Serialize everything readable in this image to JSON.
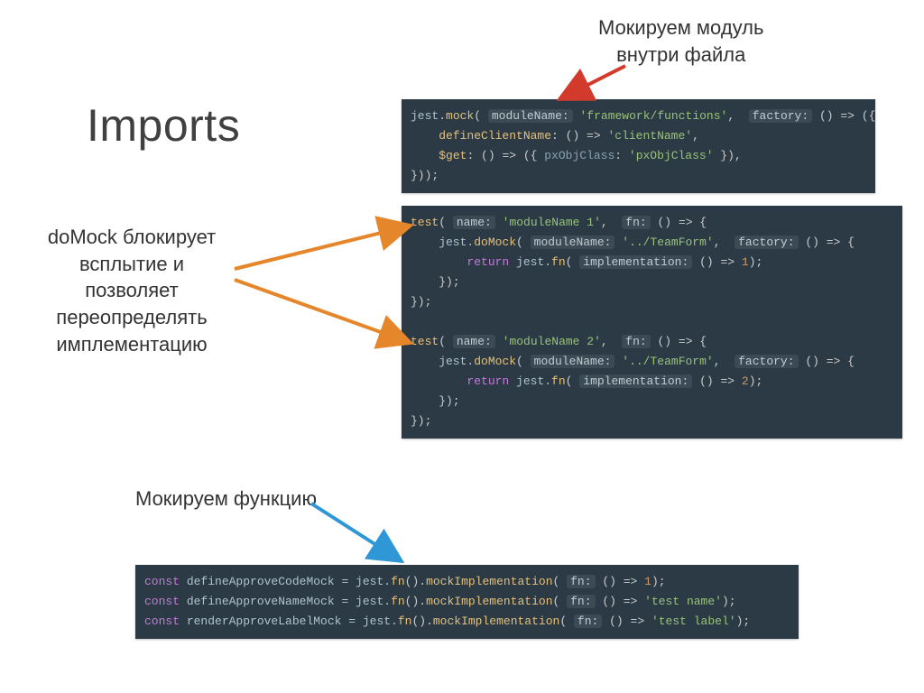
{
  "title": "Imports",
  "annotations": {
    "mockModule_l1": "Мокируем модуль",
    "mockModule_l2": "внутри файла",
    "doMock_l1": "doMock блокирует",
    "doMock_l2": "всплытие и позволяет",
    "doMock_l3": "переопределять",
    "doMock_l4": "имплементацию",
    "mockFn": "Мокируем функцию"
  },
  "code1": {
    "l1_a": "jest",
    "l1_b": ".",
    "l1_c": "mock",
    "l1_d": "( ",
    "l1_hint": "moduleName:",
    "l1_e": " ",
    "l1_str": "'framework/functions'",
    "l1_f": ",  ",
    "l1_hint2": "factory:",
    "l1_g": " () => ({",
    "l2_a": "    ",
    "l2_key": "defineClientName",
    "l2_b": ": () => ",
    "l2_str": "'clientName'",
    "l2_c": ",",
    "l3_a": "    ",
    "l3_key": "$get",
    "l3_b": ": () => ({ ",
    "l3_k2": "pxObjClass",
    "l3_c": ": ",
    "l3_str": "'pxObjClass'",
    "l3_d": " }),",
    "l4": "}));"
  },
  "code2": {
    "t1_a": "test",
    "t1_b": "( ",
    "t1_hint": "name:",
    "t1_c": " ",
    "t1_str": "'moduleName 1'",
    "t1_d": ",  ",
    "t1_hint2": "fn:",
    "t1_e": " () => {",
    "t2_a": "    jest.",
    "t2_fn": "doMock",
    "t2_b": "( ",
    "t2_hint": "moduleName:",
    "t2_c": " ",
    "t2_str": "'../TeamForm'",
    "t2_d": ",  ",
    "t2_hint2": "factory:",
    "t2_e": " () => {",
    "t3_a": "        ",
    "t3_kw": "return",
    "t3_b": " jest.",
    "t3_fn": "fn",
    "t3_c": "( ",
    "t3_hint": "implementation:",
    "t3_d": " () => ",
    "t3_num": "1",
    "t3_e": ");",
    "t4": "    });",
    "t5": "});",
    "blank": " ",
    "u1_a": "test",
    "u1_b": "( ",
    "u1_hint": "name:",
    "u1_c": " ",
    "u1_str": "'moduleName 2'",
    "u1_d": ",  ",
    "u1_hint2": "fn:",
    "u1_e": " () => {",
    "u2_a": "    jest.",
    "u2_fn": "doMock",
    "u2_b": "( ",
    "u2_hint": "moduleName:",
    "u2_c": " ",
    "u2_str": "'../TeamForm'",
    "u2_d": ",  ",
    "u2_hint2": "factory:",
    "u2_e": " () => {",
    "u3_a": "        ",
    "u3_kw": "return",
    "u3_b": " jest.",
    "u3_fn": "fn",
    "u3_c": "( ",
    "u3_hint": "implementation:",
    "u3_d": " () => ",
    "u3_num": "2",
    "u3_e": ");",
    "u4": "    });",
    "u5": "});"
  },
  "code3": {
    "c1_kw": "const",
    "c1_a": " defineApproveCodeMock = jest.",
    "c1_fn": "fn",
    "c1_b": "().",
    "c1_fn2": "mockImplementation",
    "c1_c": "( ",
    "c1_hint": "fn:",
    "c1_d": " () => ",
    "c1_num": "1",
    "c1_e": ");",
    "c2_kw": "const",
    "c2_a": " defineApproveNameMock = jest.",
    "c2_fn": "fn",
    "c2_b": "().",
    "c2_fn2": "mockImplementation",
    "c2_c": "( ",
    "c2_hint": "fn:",
    "c2_d": " () => ",
    "c2_str": "'test name'",
    "c2_e": ");",
    "c3_kw": "const",
    "c3_a": " renderApproveLabelMock = jest.",
    "c3_fn": "fn",
    "c3_b": "().",
    "c3_fn2": "mockImplementation",
    "c3_c": "( ",
    "c3_hint": "fn:",
    "c3_d": " () => ",
    "c3_str": "'test label'",
    "c3_e": ");"
  }
}
